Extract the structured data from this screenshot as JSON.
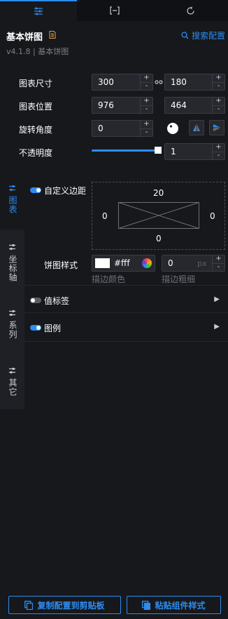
{
  "tabs": [
    {
      "icon": "sliders-icon",
      "active": true
    },
    {
      "icon": "bracket-icon",
      "active": false
    },
    {
      "icon": "refresh-icon",
      "active": false
    }
  ],
  "header": {
    "title": "基本饼图",
    "search_label": "搜索配置",
    "version": "v4.1.8 | 基本饼图"
  },
  "props": {
    "size_label": "图表尺寸",
    "width": "300",
    "height": "180",
    "position_label": "图表位置",
    "pos_x": "976",
    "pos_y": "464",
    "rotation_label": "旋转角度",
    "rotation": "0",
    "opacity_label": "不透明度",
    "opacity": "1",
    "opacity_level": 1
  },
  "stepper": {
    "plus": "+",
    "minus": "-"
  },
  "sidenav": {
    "items": [
      {
        "label": "图表",
        "active": true
      },
      {
        "label": "坐标轴",
        "active": false
      },
      {
        "label": "系列",
        "active": false
      },
      {
        "label": "其它",
        "active": false
      }
    ]
  },
  "chart": {
    "margin_label": "自定义边距",
    "margin_top": "20",
    "margin_left": "0",
    "margin_right": "0",
    "margin_bottom": "0",
    "pie_style_label": "饼图样式",
    "stroke_color": "#fff",
    "stroke_width": "0",
    "stroke_unit": "px",
    "stroke_color_label": "描边颜色",
    "stroke_width_label": "描边粗细",
    "value_label": "值标签",
    "legend_label": "图例",
    "expand_glyph": "▶"
  },
  "footer": {
    "copy_label": "复制配置到剪贴板",
    "paste_label": "粘贴组件样式"
  },
  "colors": {
    "accent": "#2d8cf0",
    "background": "#16181c"
  }
}
